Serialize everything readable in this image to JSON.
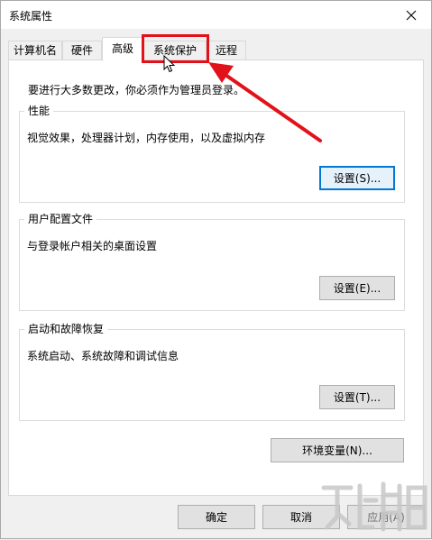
{
  "window": {
    "title": "系统属性"
  },
  "tabs": [
    {
      "label": "计算机名",
      "active": false
    },
    {
      "label": "硬件",
      "active": false
    },
    {
      "label": "高级",
      "active": true
    },
    {
      "label": "系统保护",
      "active": false
    },
    {
      "label": "远程",
      "active": false
    }
  ],
  "panel": {
    "intro": "要进行大多数更改，你必须作为管理员登录。",
    "groups": [
      {
        "title": "性能",
        "description": "视觉效果，处理器计划，内存使用，以及虚拟内存",
        "button": "设置(S)..."
      },
      {
        "title": "用户配置文件",
        "description": "与登录帐户相关的桌面设置",
        "button": "设置(E)..."
      },
      {
        "title": "启动和故障恢复",
        "description": "系统启动、系统故障和调试信息",
        "button": "设置(T)..."
      }
    ],
    "env_button": "环境变量(N)..."
  },
  "footer": {
    "ok": "确定",
    "cancel": "取消",
    "apply": "应用(A)"
  },
  "annotation": {
    "highlight_color": "#e3111a"
  },
  "icons": {
    "close": "close-icon",
    "cursor": "mouse-pointer-icon",
    "watermark": "watermark-logo-icon"
  }
}
